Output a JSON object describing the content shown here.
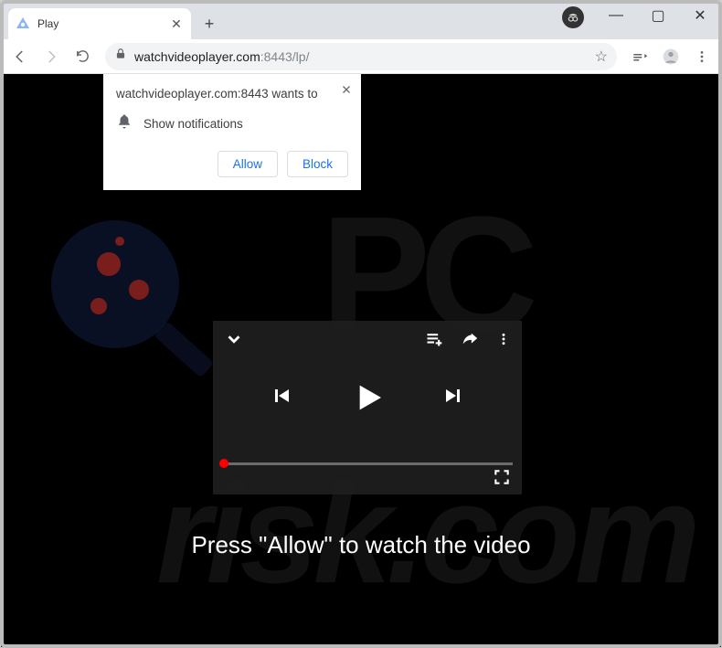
{
  "window": {
    "tab_title": "Play",
    "url_host": "watchvideoplayer.com",
    "url_rest": ":8443/lp/"
  },
  "notification": {
    "origin": "watchvideoplayer.com:8443 wants to",
    "prompt": "Show notifications",
    "allow": "Allow",
    "block": "Block"
  },
  "page": {
    "cta": "Press \"Allow\" to watch the video"
  },
  "watermark": {
    "pc": "PC",
    "risk": "risk.com"
  },
  "icons": {
    "minimize": "—",
    "maximize": "▢",
    "close_win": "✕",
    "tab_close": "✕",
    "new_tab": "+",
    "star": "☆"
  }
}
